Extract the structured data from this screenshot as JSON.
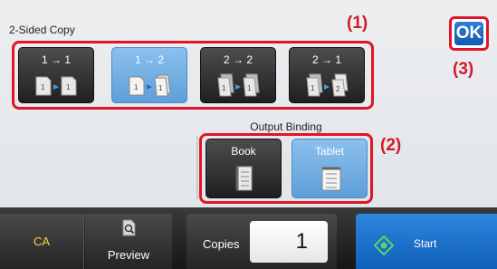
{
  "screen": {
    "title": "2-Sided Copy",
    "output_binding_label": "Output Binding",
    "ok_label": "OK"
  },
  "callouts": {
    "c1": "(1)",
    "c2": "(2)",
    "c3": "(3)"
  },
  "modes": [
    {
      "label": "1 → 1",
      "selected": false,
      "icon": "one-to-one-icon"
    },
    {
      "label": "1 → 2",
      "selected": true,
      "icon": "one-to-two-icon"
    },
    {
      "label": "2 → 2",
      "selected": false,
      "icon": "two-to-two-icon"
    },
    {
      "label": "2 → 1",
      "selected": false,
      "icon": "two-to-one-icon"
    }
  ],
  "binding": [
    {
      "label": "Book",
      "selected": false,
      "icon": "book-icon"
    },
    {
      "label": "Tablet",
      "selected": true,
      "icon": "tablet-icon"
    }
  ],
  "bottom_bar": {
    "ca_label": "CA",
    "preview_label": "Preview",
    "copies_label": "Copies",
    "copies_value": "1",
    "start_label": "Start"
  },
  "colors": {
    "accent_blue": "#2f7fd6",
    "selected_blue": "#6aa8e0",
    "callout_red": "#d6182a",
    "ca_yellow": "#ffd23a",
    "start_green": "#5bd36a"
  }
}
